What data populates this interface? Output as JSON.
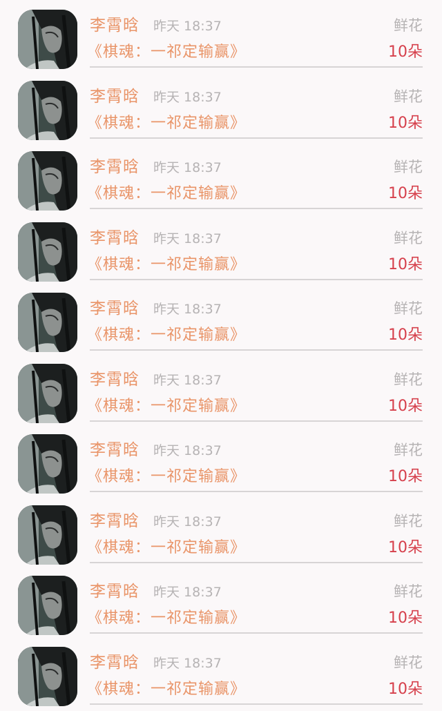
{
  "gift_list": {
    "items": [
      {
        "user_name": "李霄晗",
        "time": "昨天 18:37",
        "gift_type": "鲜花",
        "book_title": "《棋魂：一祁定输赢》",
        "gift_count": "10朵"
      },
      {
        "user_name": "李霄晗",
        "time": "昨天 18:37",
        "gift_type": "鲜花",
        "book_title": "《棋魂：一祁定输赢》",
        "gift_count": "10朵"
      },
      {
        "user_name": "李霄晗",
        "time": "昨天 18:37",
        "gift_type": "鲜花",
        "book_title": "《棋魂：一祁定输赢》",
        "gift_count": "10朵"
      },
      {
        "user_name": "李霄晗",
        "time": "昨天 18:37",
        "gift_type": "鲜花",
        "book_title": "《棋魂：一祁定输赢》",
        "gift_count": "10朵"
      },
      {
        "user_name": "李霄晗",
        "time": "昨天 18:37",
        "gift_type": "鲜花",
        "book_title": "《棋魂：一祁定输赢》",
        "gift_count": "10朵"
      },
      {
        "user_name": "李霄晗",
        "time": "昨天 18:37",
        "gift_type": "鲜花",
        "book_title": "《棋魂：一祁定输赢》",
        "gift_count": "10朵"
      },
      {
        "user_name": "李霄晗",
        "time": "昨天 18:37",
        "gift_type": "鲜花",
        "book_title": "《棋魂：一祁定输赢》",
        "gift_count": "10朵"
      },
      {
        "user_name": "李霄晗",
        "time": "昨天 18:37",
        "gift_type": "鲜花",
        "book_title": "《棋魂：一祁定输赢》",
        "gift_count": "10朵"
      },
      {
        "user_name": "李霄晗",
        "time": "昨天 18:37",
        "gift_type": "鲜花",
        "book_title": "《棋魂：一祁定输赢》",
        "gift_count": "10朵"
      },
      {
        "user_name": "李霄晗",
        "time": "昨天 18:37",
        "gift_type": "鲜花",
        "book_title": "《棋魂：一祁定输赢》",
        "gift_count": "10朵"
      }
    ]
  },
  "colors": {
    "background": "#fbf8f9",
    "name_accent": "#e99468",
    "count_red": "#d6404c",
    "muted_gray": "#b6b3b4",
    "divider": "#d7d4d5"
  }
}
